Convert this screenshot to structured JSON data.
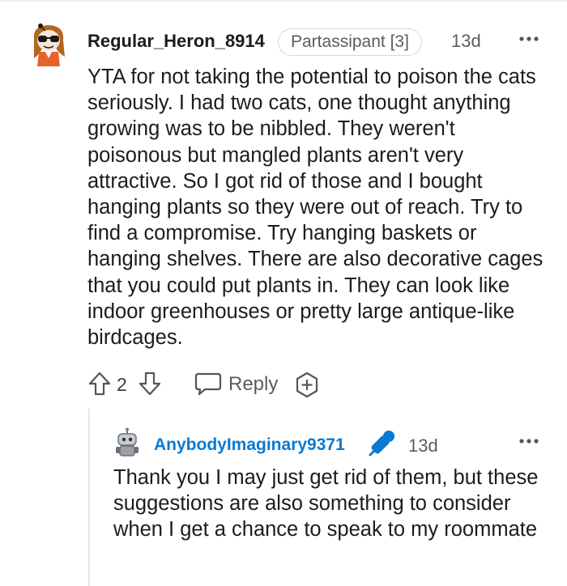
{
  "comment": {
    "author": "Regular_Heron_8914",
    "flair": "Partassipant [3]",
    "time": "13d",
    "avatar": "snoo-avatar-orange-hair-sunglasses",
    "body": "YTA for not taking the potential to poison the cats seriously. I had two cats, one thought anything growing was to be nibbled. They weren't poisonous but mangled plants aren't very attractive. So I got rid of those and I bought hanging plants so they were out of reach. Try to find a compromise. Try hanging baskets or hanging shelves. There are also decorative cages that you could put plants in. They can look like indoor greenhouses or pretty large antique-like birdcages.",
    "score": "2",
    "reply_label": "Reply",
    "icons": {
      "more": "more-options-icon",
      "upvote": "upvote-arrow-icon",
      "downvote": "downvote-arrow-icon",
      "reply": "speech-bubble-icon",
      "award": "award-plus-icon"
    }
  },
  "reply": {
    "author": "AnybodyImaginary9371",
    "author_badge": "microphone-op-icon",
    "time": "13d",
    "avatar": "snoo-avatar-robot",
    "body": "Thank you I may just get rid of them, but these suggestions are also something to consider when I get a chance to speak to my roommate"
  },
  "colors": {
    "author_reply": "#0a79d1",
    "text": "#1c1c1c",
    "meta": "#5c5c5c",
    "thread_line": "#e4e6e8"
  }
}
